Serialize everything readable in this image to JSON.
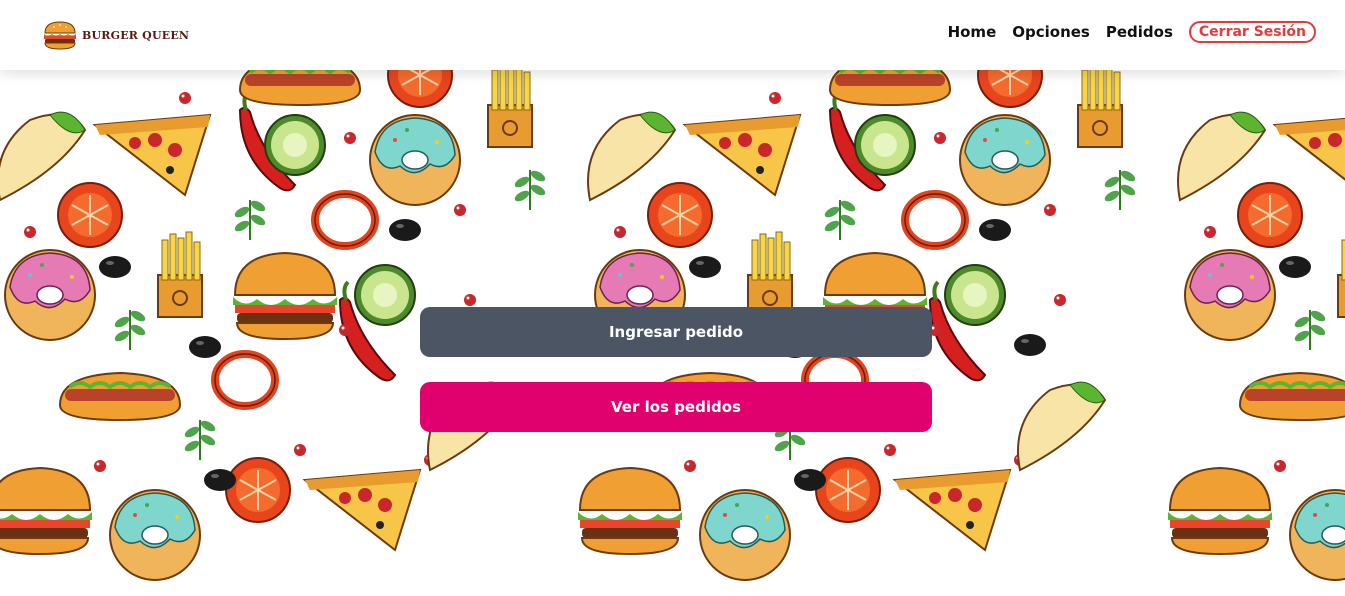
{
  "brand": {
    "name": "BURGER QUEEN",
    "logo_icon": "burger-icon"
  },
  "nav": {
    "home": "Home",
    "opciones": "Opciones",
    "pedidos": "Pedidos",
    "logout": "Cerrar Sesión"
  },
  "actions": {
    "ingresar": "Ingresar pedido",
    "ver": "Ver los pedidos"
  },
  "colors": {
    "ingresar_bg": "#4b5563",
    "ver_bg": "#e0006e",
    "logout_accent": "#e23b3b"
  },
  "background": {
    "pattern": "food-doodle-pattern"
  }
}
